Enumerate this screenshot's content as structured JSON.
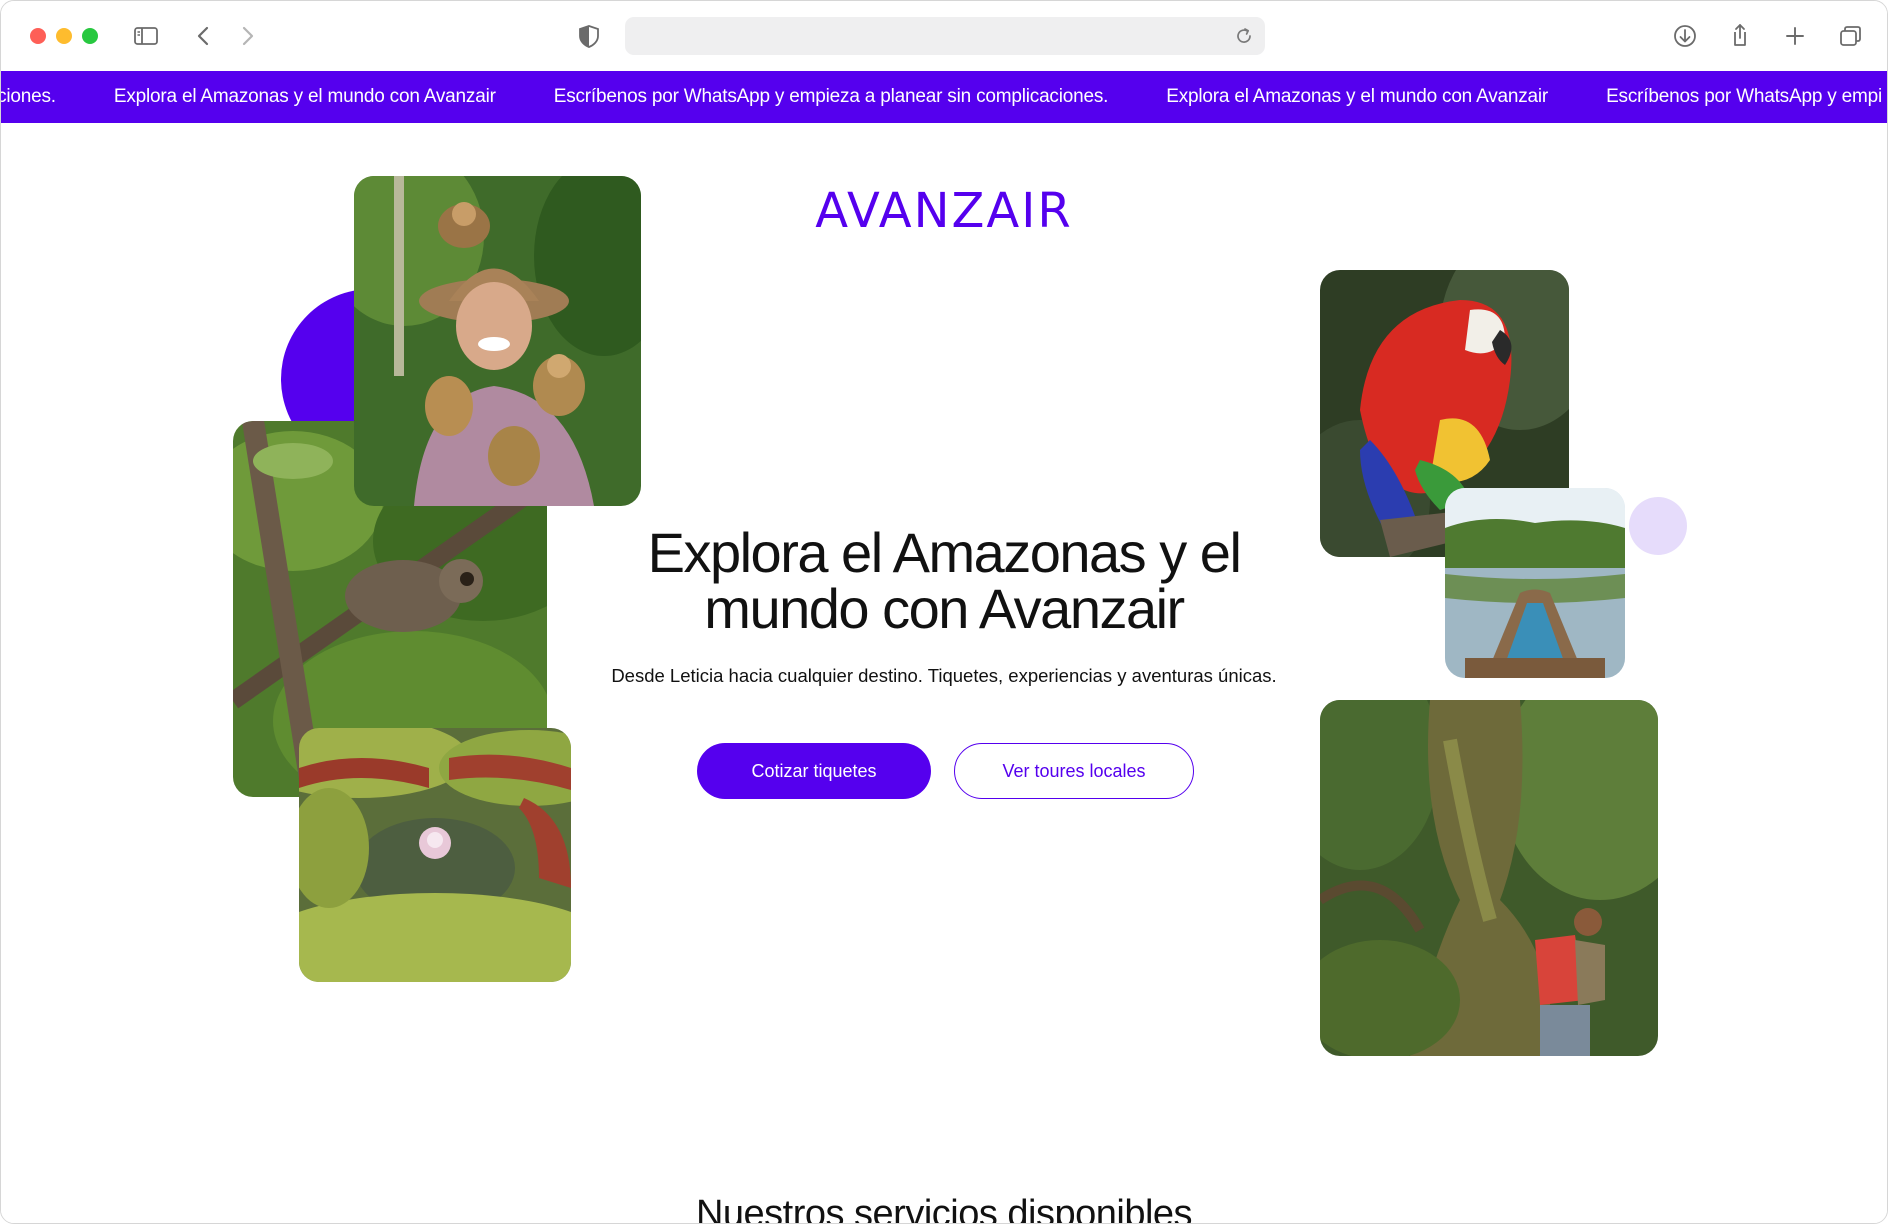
{
  "browser": {
    "url_value": "",
    "url_placeholder": ""
  },
  "marquee": {
    "items": [
      "plicaciones.",
      "Explora el Amazonas y el mundo con Avanzair",
      "Escríbenos por WhatsApp y empieza a planear sin complicaciones.",
      "Explora el Amazonas y el mundo con Avanzair",
      "Escríbenos por WhatsApp y empi"
    ]
  },
  "brand": {
    "logo": "AVANZAIR"
  },
  "hero": {
    "title_line1": "Explora el Amazonas y el",
    "title_line2": "mundo con Avanzair",
    "subtitle": "Desde Leticia hacia cualquier destino. Tiquetes, experiencias y aventuras únicas.",
    "primary_button": "Cotizar tiquetes",
    "secondary_button": "Ver toures locales"
  },
  "services": {
    "title": "Nuestros servicios disponibles"
  },
  "colors": {
    "accent": "#5500ee",
    "lavender": "#e6dcfb"
  },
  "icons": [
    "sidebar-icon",
    "back-icon",
    "forward-icon",
    "shield-icon",
    "reload-icon",
    "download-icon",
    "share-icon",
    "new-tab-icon",
    "tabs-overview-icon"
  ]
}
